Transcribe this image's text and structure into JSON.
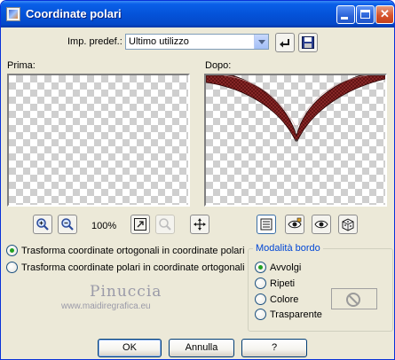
{
  "window": {
    "title": "Coordinate polari",
    "icon": "plugin-app-icon",
    "controls": {
      "minimize_icon": "minimize-icon",
      "maximize_icon": "maximize-icon",
      "close_glyph": "✕"
    }
  },
  "presets": {
    "label": "Imp. predef.:",
    "selected": "Ultimo utilizzo",
    "reset_icon": "reset-arrow-icon",
    "save_icon": "floppy-save-icon"
  },
  "previews": {
    "before_label": "Prima:",
    "after_label": "Dopo:"
  },
  "zoom": {
    "zoom_in_icon": "magnifier-plus-icon",
    "zoom_out_icon": "magnifier-minus-icon",
    "level": "100%",
    "fit_icon": "zoom-to-fit-icon",
    "disabled_icon": "magnifier-disabled-icon",
    "pan_icon": "pan-move-icon"
  },
  "view_tools": {
    "icons": [
      "proof-list-icon",
      "preview-on-image-icon",
      "eye-toggle-icon",
      "randomize-dice-icon"
    ]
  },
  "transform": {
    "options": [
      {
        "label": "Trasforma coordinate ortogonali in coordinate polari",
        "checked": true
      },
      {
        "label": "Trasforma coordinate polari in coordinate ortogonali",
        "checked": false
      }
    ]
  },
  "edge_mode": {
    "title": "Modalità bordo",
    "options": [
      {
        "label": "Avvolgi",
        "checked": true
      },
      {
        "label": "Ripeti",
        "checked": false
      },
      {
        "label": "Colore",
        "checked": false
      },
      {
        "label": "Trasparente",
        "checked": false
      }
    ],
    "color_swatch_icon": "no-color-circle-icon"
  },
  "watermark": {
    "name": "Pinuccia",
    "url": "www.maidiregrafica.eu"
  },
  "buttons": {
    "ok": "OK",
    "cancel": "Annulla",
    "help": "?"
  },
  "colors": {
    "title_bar": "#0453d9",
    "dialog_bg": "#ece9d8",
    "group_title": "#0046d5",
    "preview_shape": "#6b1414",
    "radio_check": "#21a121"
  }
}
